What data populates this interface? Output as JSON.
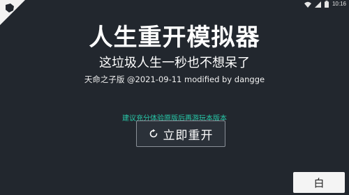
{
  "status": {
    "time": "10:16",
    "icons": [
      "wifi-icon",
      "cellular-icon",
      "battery-icon"
    ]
  },
  "header": {
    "title": "人生重开模拟器",
    "subtitle": "这垃圾人生一秒也不想呆了",
    "credit": "天命之子版 @2021-09-11 modified by dangge"
  },
  "hint": "建议充分体验原版后再游玩本版本",
  "actions": {
    "restart_label": "立即重开",
    "restart_icon": "refresh-icon",
    "theme_label": "白"
  },
  "colors": {
    "background": "#22272e",
    "accent_hint": "#28c9a9",
    "button_border": "#8a9098"
  }
}
